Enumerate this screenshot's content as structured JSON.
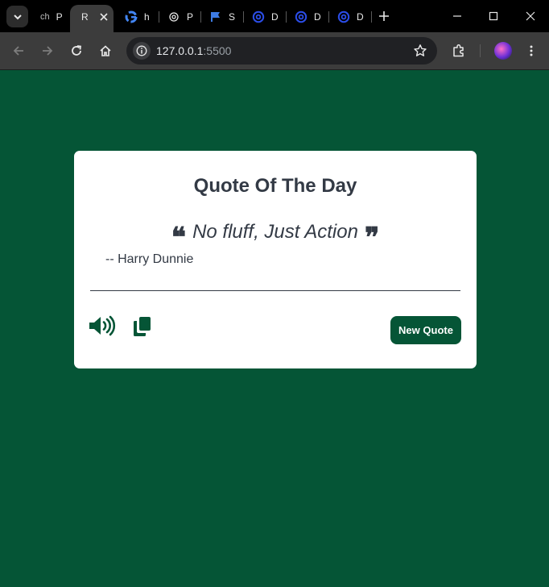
{
  "browser": {
    "tabs": [
      {
        "icon": "chatgpt-text-icon",
        "label": "P",
        "prefix": "ch"
      },
      {
        "icon": "none",
        "label": "R",
        "active": true
      },
      {
        "icon": "google-icon",
        "label": "h"
      },
      {
        "icon": "openai-icon",
        "label": "P"
      },
      {
        "icon": "flag-icon",
        "label": "S"
      },
      {
        "icon": "at-sign-icon",
        "label": "D"
      },
      {
        "icon": "at-sign-icon",
        "label": "D"
      },
      {
        "icon": "at-sign-icon",
        "label": "D"
      }
    ],
    "url_host": "127.0.0.1",
    "url_port": ":5500"
  },
  "colors": {
    "page_bg": "#055536",
    "card_bg": "#ffffff",
    "text": "#333a45",
    "accent": "#055536"
  },
  "card": {
    "title": "Quote Of The Day",
    "open_quote": "❝",
    "close_quote": "❞",
    "quote": "No fluff, Just Action",
    "author": "-- Harry Dunnie",
    "new_quote_label": "New Quote",
    "speak_icon": "volume-icon",
    "copy_icon": "copy-icon"
  }
}
